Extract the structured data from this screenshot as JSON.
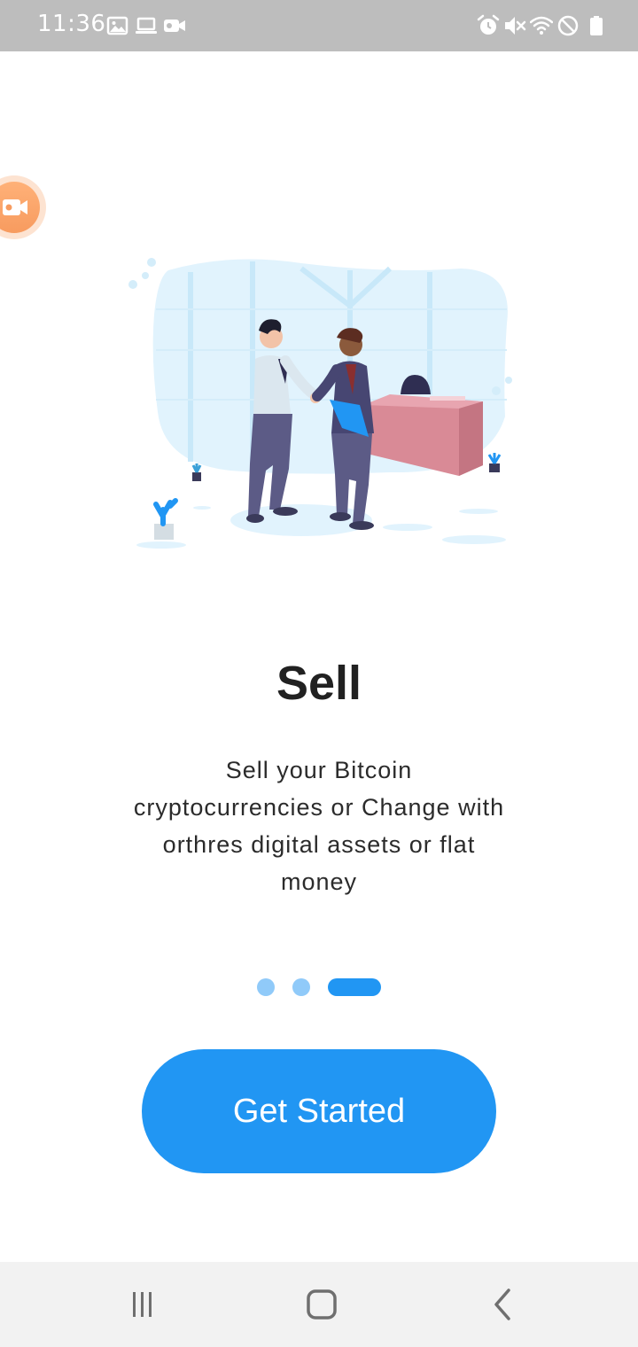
{
  "status_bar": {
    "time": "11:36",
    "left_icons": [
      "gallery-icon",
      "laptop-icon",
      "video-camera-icon"
    ],
    "right_icons": [
      "alarm-icon",
      "mute-icon",
      "wifi-icon",
      "do-not-disturb-icon",
      "battery-icon"
    ]
  },
  "recorder": {
    "icon": "video-camera-icon",
    "color": "#f79b5f"
  },
  "onboarding": {
    "title": "Sell",
    "description": "Sell your Bitcoin cryptocurrencies or Change with orthres digital assets or flat money",
    "page_count": 3,
    "current_page": 3
  },
  "cta": {
    "label": "Get Started",
    "color": "#2196f3"
  },
  "nav_bar": {
    "items": [
      "recent-apps-icon",
      "home-icon",
      "back-icon"
    ]
  },
  "colors": {
    "accent": "#2196f3",
    "indicator_inactive": "#90caf9",
    "illustration_background": "#e1f3fd"
  }
}
